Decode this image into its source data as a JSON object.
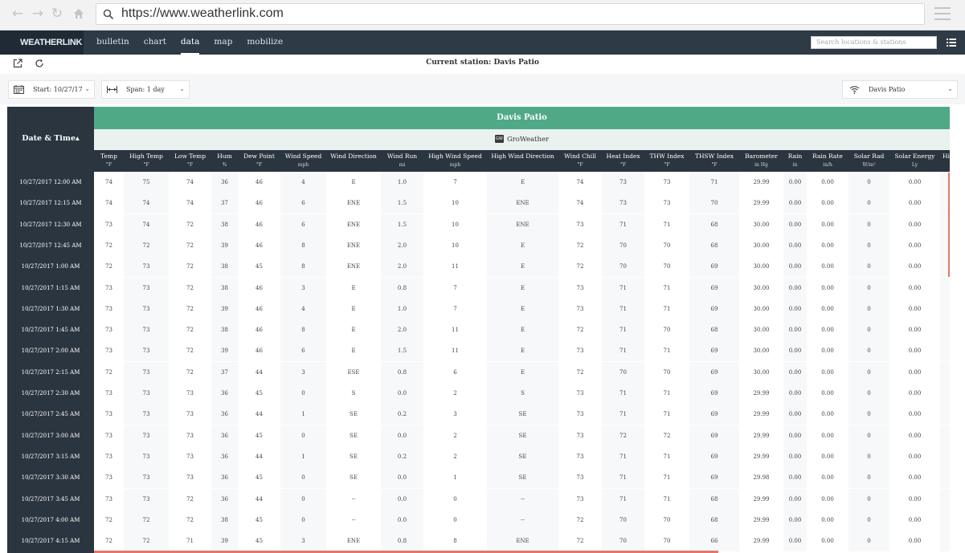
{
  "browser": {
    "url": "https://www.weatherlink.com",
    "icons": [
      "arrow-left-icon",
      "arrow-right-icon",
      "reload-icon",
      "home-icon",
      "search-icon",
      "menu-icon"
    ]
  },
  "nav": {
    "logo": "WEATHERLINK",
    "links": [
      {
        "label": "bulletin",
        "active": false
      },
      {
        "label": "chart",
        "active": false
      },
      {
        "label": "data",
        "active": true
      },
      {
        "label": "map",
        "active": false
      },
      {
        "label": "mobilize",
        "active": false
      }
    ],
    "search_placeholder": "Search locations & stations"
  },
  "station_bar": {
    "current_station": "Current station: Davis Patio"
  },
  "controls": {
    "start": "Start: 10/27/17",
    "span": "Span: 1 day",
    "station": "Davis Patio"
  },
  "table": {
    "date_header": "Date & Time",
    "station_name": "Davis Patio",
    "device_name": "GroWeather",
    "device_badge": "GW",
    "columns": [
      {
        "label": "Temp",
        "unit": "°F"
      },
      {
        "label": "High Temp",
        "unit": "°F"
      },
      {
        "label": "Low Temp",
        "unit": "°F"
      },
      {
        "label": "Hum",
        "unit": "%"
      },
      {
        "label": "Dew Point",
        "unit": "°F"
      },
      {
        "label": "Wind Speed",
        "unit": "mph"
      },
      {
        "label": "Wind Direction",
        "unit": ""
      },
      {
        "label": "Wind Run",
        "unit": "mi"
      },
      {
        "label": "High Wind Speed",
        "unit": "mph"
      },
      {
        "label": "High Wind Direction",
        "unit": ""
      },
      {
        "label": "Wind Chill",
        "unit": "°F"
      },
      {
        "label": "Heat Index",
        "unit": "°F"
      },
      {
        "label": "THW Index",
        "unit": "°F"
      },
      {
        "label": "THSW Index",
        "unit": "°F"
      },
      {
        "label": "Barometer",
        "unit": "in Hg"
      },
      {
        "label": "Rain",
        "unit": "in"
      },
      {
        "label": "Rain Rate",
        "unit": "in/h"
      },
      {
        "label": "Solar Rad",
        "unit": "W/m²"
      },
      {
        "label": "Solar Energy",
        "unit": "Ly"
      },
      {
        "label": "Hi",
        "unit": ""
      }
    ],
    "rows": [
      {
        "time": "10/27/2017 12:00 AM",
        "cells": [
          "74",
          "75",
          "74",
          "36",
          "46",
          "4",
          "E",
          "1.0",
          "7",
          "E",
          "74",
          "73",
          "73",
          "71",
          "29.99",
          "0.00",
          "0.00",
          "0",
          "0.00",
          ""
        ]
      },
      {
        "time": "10/27/2017 12:15 AM",
        "cells": [
          "74",
          "74",
          "74",
          "37",
          "46",
          "6",
          "ENE",
          "1.5",
          "10",
          "ENE",
          "74",
          "73",
          "73",
          "70",
          "29.99",
          "0.00",
          "0.00",
          "0",
          "0.00",
          ""
        ]
      },
      {
        "time": "10/27/2017 12:30 AM",
        "cells": [
          "73",
          "74",
          "72",
          "38",
          "46",
          "6",
          "ENE",
          "1.5",
          "10",
          "ENE",
          "73",
          "71",
          "71",
          "68",
          "30.00",
          "0.00",
          "0.00",
          "0",
          "0.00",
          ""
        ]
      },
      {
        "time": "10/27/2017 12:45 AM",
        "cells": [
          "72",
          "72",
          "72",
          "39",
          "46",
          "8",
          "ENE",
          "2.0",
          "10",
          "E",
          "72",
          "70",
          "70",
          "68",
          "30.00",
          "0.00",
          "0.00",
          "0",
          "0.00",
          ""
        ]
      },
      {
        "time": "10/27/2017 1:00 AM",
        "cells": [
          "72",
          "73",
          "72",
          "38",
          "45",
          "8",
          "ENE",
          "2.0",
          "11",
          "E",
          "72",
          "70",
          "70",
          "69",
          "30.00",
          "0.00",
          "0.00",
          "0",
          "0.00",
          ""
        ]
      },
      {
        "time": "10/27/2017 1:15 AM",
        "cells": [
          "73",
          "73",
          "72",
          "38",
          "46",
          "3",
          "E",
          "0.8",
          "7",
          "E",
          "73",
          "71",
          "71",
          "69",
          "30.00",
          "0.00",
          "0.00",
          "0",
          "0.00",
          ""
        ]
      },
      {
        "time": "10/27/2017 1:30 AM",
        "cells": [
          "73",
          "73",
          "72",
          "39",
          "46",
          "4",
          "E",
          "1.0",
          "7",
          "E",
          "73",
          "71",
          "71",
          "69",
          "30.00",
          "0.00",
          "0.00",
          "0",
          "0.00",
          ""
        ]
      },
      {
        "time": "10/27/2017 1:45 AM",
        "cells": [
          "73",
          "73",
          "72",
          "38",
          "46",
          "8",
          "E",
          "2.0",
          "11",
          "E",
          "72",
          "71",
          "70",
          "68",
          "30.00",
          "0.00",
          "0.00",
          "0",
          "0.00",
          ""
        ]
      },
      {
        "time": "10/27/2017 2:00 AM",
        "cells": [
          "73",
          "73",
          "72",
          "39",
          "46",
          "6",
          "E",
          "1.5",
          "11",
          "E",
          "73",
          "71",
          "71",
          "69",
          "30.00",
          "0.00",
          "0.00",
          "0",
          "0.00",
          ""
        ]
      },
      {
        "time": "10/27/2017 2:15 AM",
        "cells": [
          "72",
          "73",
          "72",
          "37",
          "44",
          "3",
          "ESE",
          "0.8",
          "6",
          "E",
          "72",
          "70",
          "70",
          "69",
          "30.00",
          "0.00",
          "0.00",
          "0",
          "0.00",
          ""
        ]
      },
      {
        "time": "10/27/2017 2:30 AM",
        "cells": [
          "73",
          "73",
          "73",
          "36",
          "45",
          "0",
          "S",
          "0.0",
          "2",
          "S",
          "73",
          "71",
          "71",
          "69",
          "29.99",
          "0.00",
          "0.00",
          "0",
          "0.00",
          ""
        ]
      },
      {
        "time": "10/27/2017 2:45 AM",
        "cells": [
          "73",
          "73",
          "73",
          "36",
          "44",
          "1",
          "SE",
          "0.2",
          "3",
          "SE",
          "73",
          "71",
          "71",
          "69",
          "29.99",
          "0.00",
          "0.00",
          "0",
          "0.00",
          ""
        ]
      },
      {
        "time": "10/27/2017 3:00 AM",
        "cells": [
          "73",
          "73",
          "73",
          "36",
          "45",
          "0",
          "SE",
          "0.0",
          "2",
          "SE",
          "73",
          "72",
          "72",
          "69",
          "29.99",
          "0.00",
          "0.00",
          "0",
          "0.00",
          ""
        ]
      },
      {
        "time": "10/27/2017 3:15 AM",
        "cells": [
          "73",
          "73",
          "73",
          "36",
          "44",
          "1",
          "SE",
          "0.2",
          "2",
          "SE",
          "73",
          "71",
          "71",
          "69",
          "29.99",
          "0.00",
          "0.00",
          "0",
          "0.00",
          ""
        ]
      },
      {
        "time": "10/27/2017 3:30 AM",
        "cells": [
          "73",
          "73",
          "73",
          "36",
          "45",
          "0",
          "SE",
          "0.0",
          "1",
          "SE",
          "73",
          "71",
          "71",
          "69",
          "29.98",
          "0.00",
          "0.00",
          "0",
          "0.00",
          ""
        ]
      },
      {
        "time": "10/27/2017 3:45 AM",
        "cells": [
          "73",
          "73",
          "72",
          "36",
          "44",
          "0",
          "--",
          "0.0",
          "0",
          "--",
          "73",
          "71",
          "71",
          "68",
          "29.99",
          "0.00",
          "0.00",
          "0",
          "0.00",
          ""
        ]
      },
      {
        "time": "10/27/2017 4:00 AM",
        "cells": [
          "72",
          "72",
          "72",
          "38",
          "45",
          "0",
          "--",
          "0.0",
          "0",
          "--",
          "72",
          "70",
          "70",
          "68",
          "29.99",
          "0.00",
          "0.00",
          "0",
          "0.00",
          ""
        ]
      },
      {
        "time": "10/27/2017 4:15 AM",
        "cells": [
          "72",
          "72",
          "71",
          "39",
          "45",
          "3",
          "ENE",
          "0.8",
          "8",
          "ENE",
          "72",
          "70",
          "70",
          "66",
          "29.99",
          "0.00",
          "0.00",
          "0",
          "0.00",
          ""
        ]
      }
    ]
  }
}
